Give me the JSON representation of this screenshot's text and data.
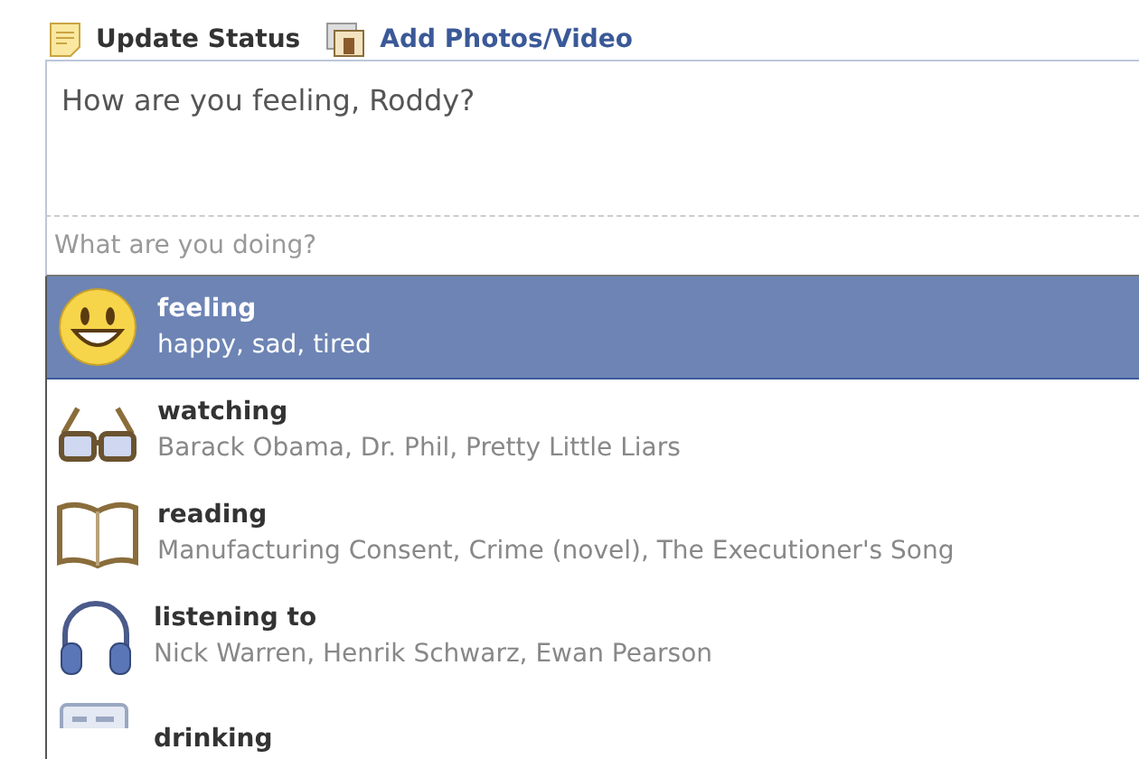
{
  "tabs": [
    {
      "label": "Update Status",
      "kind": "status",
      "selected": true
    },
    {
      "label": "Add Photos/Video",
      "kind": "photo",
      "selected": false
    }
  ],
  "composer": {
    "prompt": "How are you feeling, Roddy?"
  },
  "activity_field": {
    "placeholder": "What are you doing?"
  },
  "suggestions": [
    {
      "kind": "feeling",
      "title": "feeling",
      "subtitle": "happy, sad, tired",
      "selected": true
    },
    {
      "kind": "watching",
      "title": "watching",
      "subtitle": "Barack Obama, Dr. Phil, Pretty Little Liars",
      "selected": false
    },
    {
      "kind": "reading",
      "title": "reading",
      "subtitle": "Manufacturing Consent, Crime (novel), The Executioner's Song",
      "selected": false
    },
    {
      "kind": "listening",
      "title": "listening to",
      "subtitle": "Nick Warren, Henrik Schwarz, Ewan Pearson",
      "selected": false
    },
    {
      "kind": "drinking",
      "title": "drinking",
      "selected": false
    }
  ]
}
